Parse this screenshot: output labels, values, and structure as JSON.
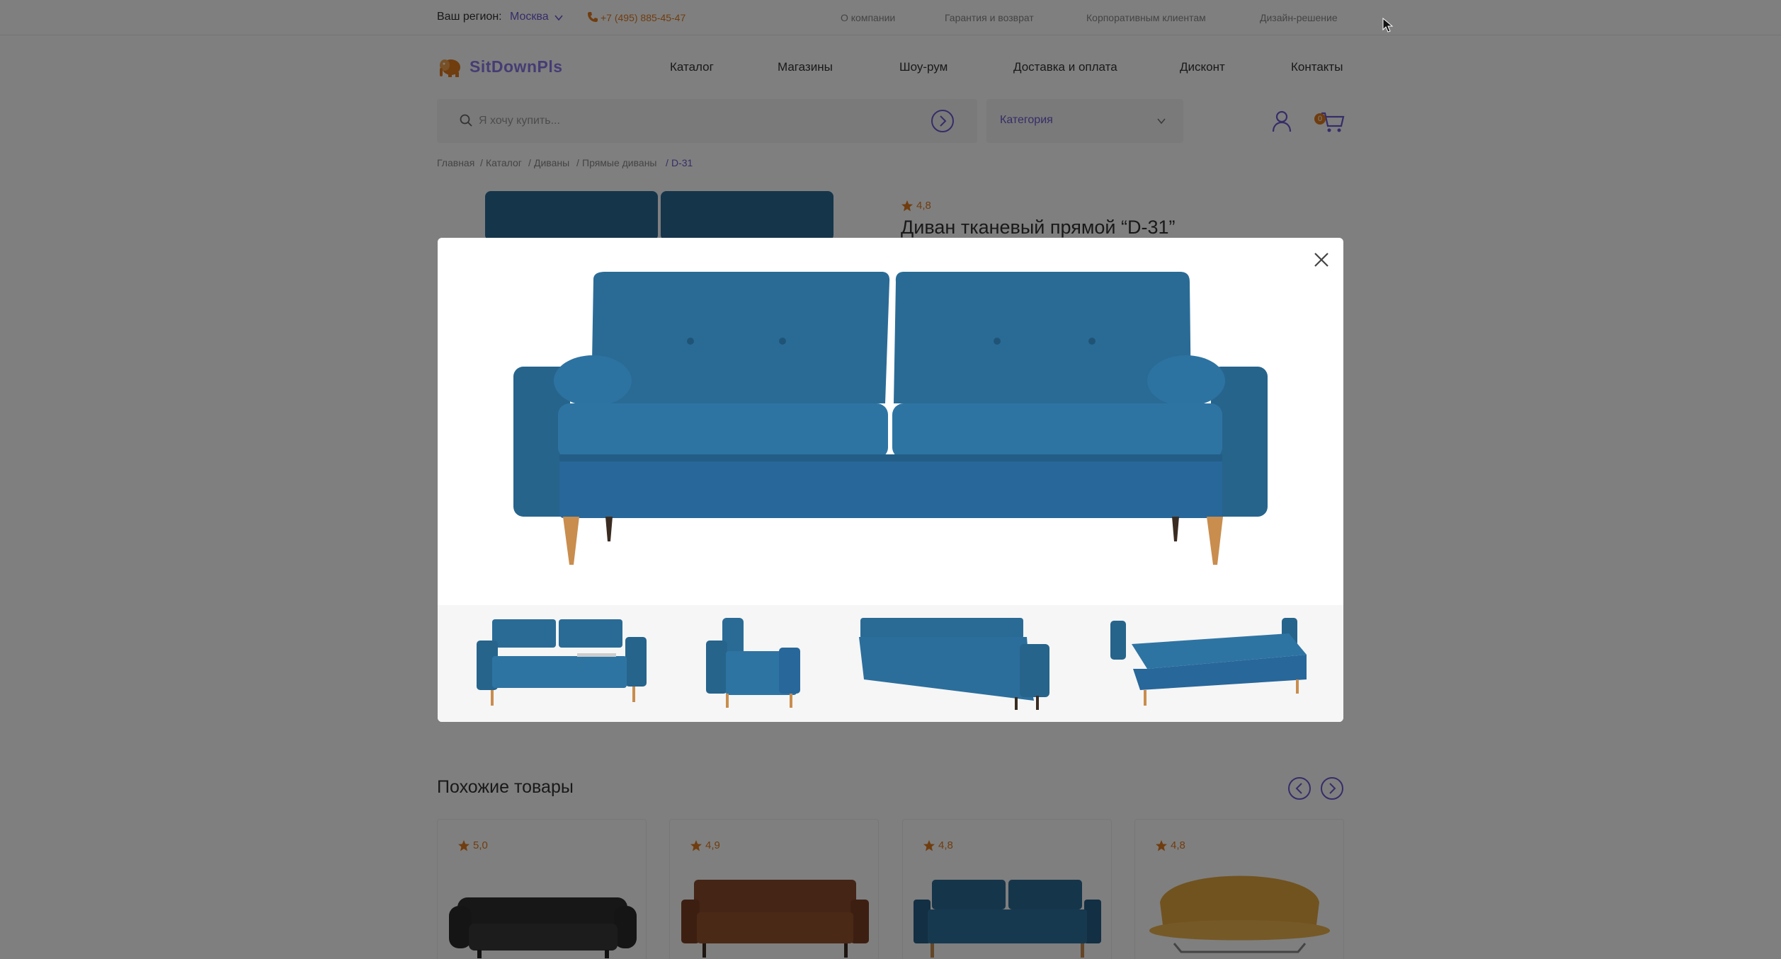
{
  "topbar": {
    "region_label": "Ваш регион:",
    "region_value": "Москва",
    "phone": "+7 (495) 885-45-47",
    "links": [
      "О компании",
      "Гарантия и возврат",
      "Корпоративным клиентам",
      "Дизайн-решение"
    ]
  },
  "header": {
    "logo_text": "SitDownPls",
    "nav": [
      "Каталог",
      "Магазины",
      "Шоу-рум",
      "Доставка и оплата",
      "Дисконт",
      "Контакты"
    ],
    "search_placeholder": "Я хочу купить...",
    "category_label": "Категория",
    "cart_count": "0"
  },
  "breadcrumb": [
    "Главная",
    "Каталог",
    "Диваны",
    "Прямые диваны",
    "D-31"
  ],
  "product": {
    "rating": "4,8",
    "title": "Диван тканевый прямой “D-31”"
  },
  "similar": {
    "title": "Похожие товары",
    "cards": [
      {
        "rating": "5,0",
        "color": "#2f2f2f"
      },
      {
        "rating": "4,9",
        "color": "#8a4a2c"
      },
      {
        "rating": "4,8",
        "color": "#2b6a95"
      },
      {
        "rating": "4,8",
        "color": "#e3a640"
      }
    ]
  },
  "modal": {
    "sofa_color": "#2a6b96",
    "leg_color": "#c98d4e"
  },
  "colors": {
    "accent": "#6b5bd2",
    "orange": "#e07b1f",
    "sofa": "#2a6b96"
  }
}
